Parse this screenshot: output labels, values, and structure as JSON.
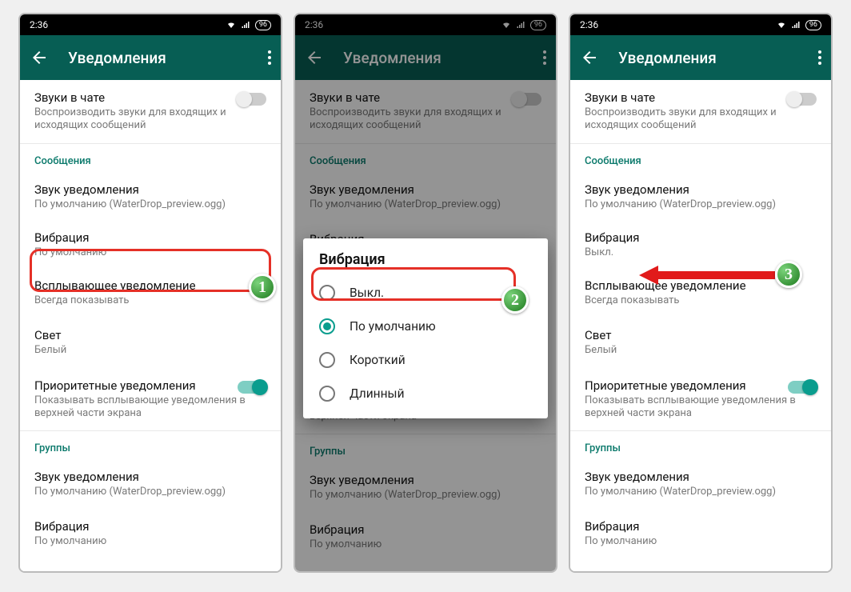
{
  "status": {
    "time": "2:36",
    "battery": "96"
  },
  "appbar": {
    "title": "Уведомления"
  },
  "chatSounds": {
    "title": "Звуки в чате",
    "sub": "Воспроизводить звуки для входящих и исходящих сообщений"
  },
  "section_messages": "Сообщения",
  "notif_sound": {
    "title": "Звук уведомления",
    "sub": "По умолчанию (WaterDrop_preview.ogg)"
  },
  "vibration": {
    "title": "Вибрация",
    "sub_default": "По умолчанию",
    "sub_off": "Выкл."
  },
  "popup": {
    "title": "Всплывающее уведомление",
    "sub": "Всегда показывать"
  },
  "light": {
    "title": "Свет",
    "sub": "Белый"
  },
  "priority": {
    "title": "Приоритетные уведомления",
    "sub": "Показывать всплывающие уведомления в верхней части экрана"
  },
  "section_groups": "Группы",
  "group_sound": {
    "title": "Звук уведомления",
    "sub": "По умолчанию (WaterDrop_preview.ogg)"
  },
  "group_vibration": {
    "title": "Вибрация",
    "sub": "По умолчанию"
  },
  "dialog": {
    "title": "Вибрация",
    "options": [
      "Выкл.",
      "По умолчанию",
      "Короткий",
      "Длинный"
    ]
  },
  "badges": [
    "1",
    "2",
    "3"
  ]
}
